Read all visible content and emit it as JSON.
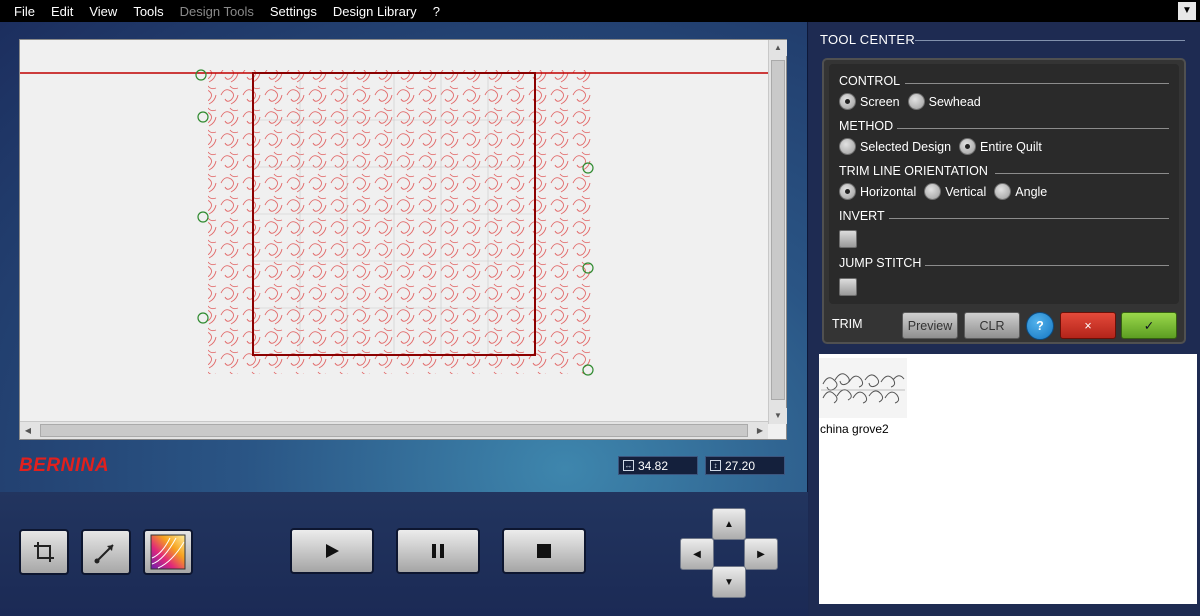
{
  "menu": {
    "items": [
      {
        "label": "File",
        "enabled": true
      },
      {
        "label": "Edit",
        "enabled": true
      },
      {
        "label": "View",
        "enabled": true
      },
      {
        "label": "Tools",
        "enabled": true
      },
      {
        "label": "Design Tools",
        "enabled": false
      },
      {
        "label": "Settings",
        "enabled": true
      },
      {
        "label": "Design Library",
        "enabled": true
      },
      {
        "label": "?",
        "enabled": true
      }
    ]
  },
  "brand": {
    "name": "BERNINA",
    "color": "#e1201d"
  },
  "dimensions": {
    "width_value": "34.82",
    "height_value": "27.20"
  },
  "tool_center": {
    "title": "TOOL CENTER",
    "control": {
      "label": "CONTROL",
      "options": [
        {
          "label": "Screen",
          "selected": true
        },
        {
          "label": "Sewhead",
          "selected": false
        }
      ]
    },
    "method": {
      "label": "METHOD",
      "options": [
        {
          "label": "Selected Design",
          "selected": false
        },
        {
          "label": "Entire Quilt",
          "selected": true
        }
      ]
    },
    "orientation": {
      "label": "TRIM LINE ORIENTATION",
      "options": [
        {
          "label": "Horizontal",
          "selected": true
        },
        {
          "label": "Vertical",
          "selected": false
        },
        {
          "label": "Angle",
          "selected": false
        }
      ]
    },
    "invert": {
      "label": "INVERT",
      "checked": false
    },
    "jump_stitch": {
      "label": "JUMP STITCH",
      "checked": false
    },
    "trim": {
      "label": "TRIM",
      "preview_label": "Preview",
      "clr_label": "CLR",
      "help_label": "?",
      "cancel_label": "×",
      "ok_label": "✓"
    }
  },
  "library": {
    "design_name": "china grove2"
  },
  "colors": {
    "stitch": "#e26a6a",
    "trim_line": "#c00000",
    "boundary": "#8b0000",
    "node_marker": "#2f8a2f",
    "accent_cancel": "#c63126",
    "accent_ok": "#78bb36"
  },
  "icons": {
    "crop_tool": "crop-icon",
    "path_tool": "path-icon",
    "color_tool": "color-gradient-icon",
    "play": "play-icon",
    "pause": "pause-icon",
    "stop": "stop-icon"
  }
}
